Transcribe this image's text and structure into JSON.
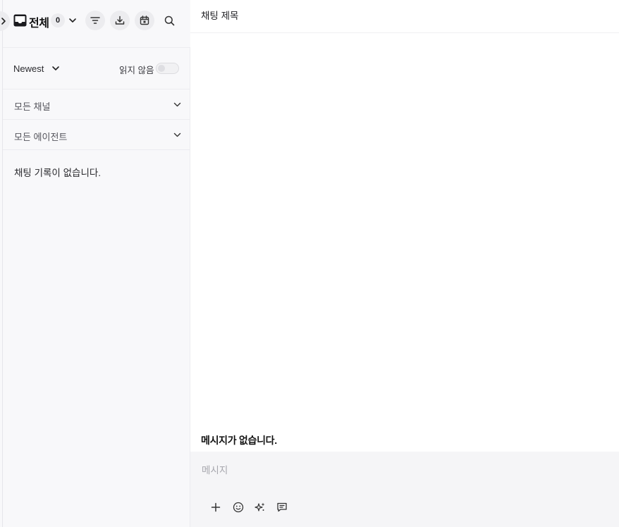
{
  "sidebar": {
    "expand_icon": "chevron-right-icon",
    "inbox": {
      "icon": "inbox-icon",
      "title": "전체",
      "count": "0"
    },
    "actions": [
      "filter-icon",
      "download-icon",
      "calendar-icon",
      "search-icon"
    ],
    "sort": {
      "label": "Newest",
      "unread_label": "읽지 않음",
      "unread_enabled": false
    },
    "filters": [
      {
        "label": "모든 채널"
      },
      {
        "label": "모든 에이전트"
      }
    ],
    "empty_text": "채팅 기록이 없습니다."
  },
  "chat": {
    "title": "채팅 제목",
    "empty_text": "메시지가 없습니다.",
    "composer": {
      "placeholder": "메시지",
      "tools": [
        "plus-icon",
        "emoji-icon",
        "sparkle-icon",
        "message-template-icon"
      ]
    }
  },
  "colors": {
    "sidebar_bg": "#f8f8fa",
    "composer_bg": "#f5f5f7",
    "button_bg": "#ececef"
  }
}
